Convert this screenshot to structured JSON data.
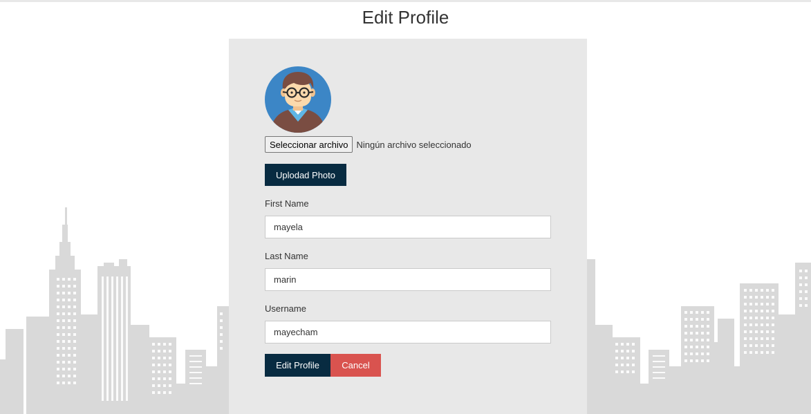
{
  "page": {
    "title": "Edit Profile"
  },
  "photo": {
    "choose_file_label": "Seleccionar archivo",
    "file_status": "Ningún archivo seleccionado",
    "upload_label": "Uplodad Photo"
  },
  "form": {
    "first_name": {
      "label": "First Name",
      "value": "mayela"
    },
    "last_name": {
      "label": "Last Name",
      "value": "marin"
    },
    "username": {
      "label": "Username",
      "value": "mayecham"
    }
  },
  "actions": {
    "edit_label": "Edit Profile",
    "cancel_label": "Cancel"
  },
  "colors": {
    "primary": "#082b41",
    "danger": "#d9534f",
    "card_bg": "#e8e8e8",
    "skyline": "#d9d9d9"
  }
}
